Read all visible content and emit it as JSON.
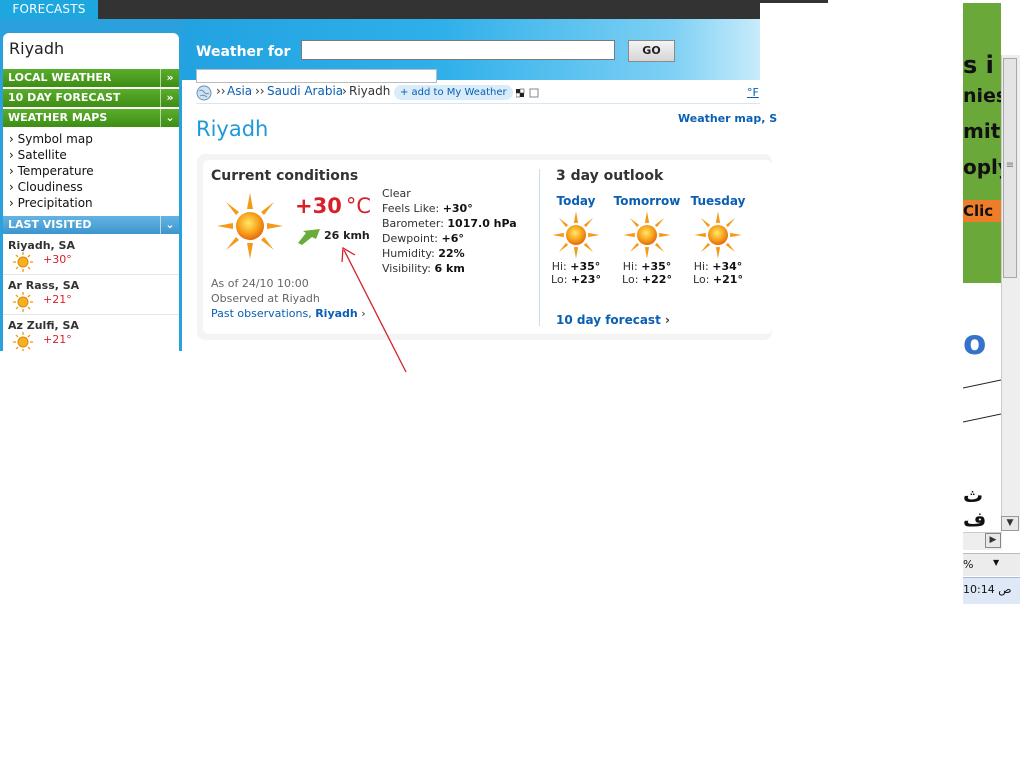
{
  "topbar": {
    "tab_label": "FORECASTS"
  },
  "header": {
    "weather_for_label": "Weather for",
    "search_value": "",
    "go_label": "GO"
  },
  "sidebar": {
    "city": "Riyadh",
    "local_weather": "LOCAL WEATHER",
    "ten_day_forecast": "10 DAY FORECAST",
    "weather_maps": "WEATHER MAPS",
    "map_links": [
      "Symbol map",
      "Satellite",
      "Temperature",
      "Cloudiness",
      "Precipitation"
    ],
    "last_visited_label": "LAST VISITED",
    "last_visited": [
      {
        "name": "Riyadh, SA",
        "temp": "+30°"
      },
      {
        "name": "Ar Rass, SA",
        "temp": "+21°"
      },
      {
        "name": "Az Zulfi, SA",
        "temp": "+21°"
      }
    ],
    "arrow_right": "»",
    "arrow_down": "¥",
    "link_prefix": "›"
  },
  "breadcrumb": {
    "sep1": "››",
    "asia": "Asia",
    "sep2": "››",
    "country": "Saudi Arabia",
    "sep3": "›",
    "city": "Riyadh",
    "add_label": "+ add to My Weather",
    "unit_f": "°F"
  },
  "title": {
    "city": "Riyadh",
    "weather_map_link": "Weather map, S"
  },
  "current": {
    "heading": "Current conditions",
    "temp": "+30",
    "unit": "°C",
    "wind": "26 kmh",
    "condition": "Clear",
    "feels_like_label": "Feels Like:",
    "feels_like": "+30°",
    "barometer_label": "Barometer:",
    "barometer": "1017.0 hPa",
    "dewpoint_label": "Dewpoint:",
    "dewpoint": "+6°",
    "humidity_label": "Humidity:",
    "humidity": "22%",
    "visibility_label": "Visibility:",
    "visibility": "6 km",
    "as_of": "As of 24/10 10:00",
    "observed": "Observed at Riyadh",
    "past_obs_label": "Past observations,",
    "past_obs_city": "Riyadh",
    "chev": "›"
  },
  "outlook": {
    "heading": "3 day outlook",
    "hi_label": "Hi:",
    "lo_label": "Lo:",
    "days": [
      {
        "name": "Today",
        "hi": "+35°",
        "lo": "+23°"
      },
      {
        "name": "Tomorrow",
        "hi": "+35°",
        "lo": "+22°"
      },
      {
        "name": "Tuesday",
        "hi": "+34°",
        "lo": "+21°"
      }
    ],
    "ten_day_link": "10 day forecast",
    "chev": "›"
  },
  "right_window": {
    "ad_lines": [
      "s i",
      "nies",
      "mit",
      "oply"
    ],
    "ad_button": "Clic",
    "logo_fragment": "o",
    "arabic_fragment": "ث ف",
    "zoom": "%",
    "clock": "10:14 ص",
    "scroll_down": "▼",
    "scroll_right": "▶",
    "zoom_drop": "▼",
    "grip": "≡"
  },
  "colors": {
    "accent_blue": "#1f9ad8",
    "temp_red": "#d8202a",
    "nav_green": "#4c9d20",
    "link_blue": "#0a5fb3"
  }
}
